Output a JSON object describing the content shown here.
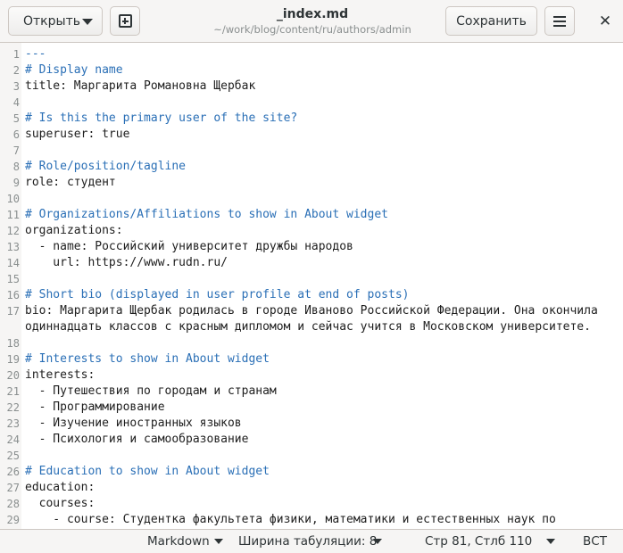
{
  "header": {
    "open_label": "Открыть",
    "save_label": "Сохранить",
    "title": "_index.md",
    "path": "~/work/blog/content/ru/authors/admin",
    "close_glyph": "✕"
  },
  "editor": {
    "lines": [
      {
        "n": "1",
        "text": "---",
        "kind": "comment"
      },
      {
        "n": "2",
        "text": "# Display name",
        "kind": "comment"
      },
      {
        "n": "3",
        "text": "title: Маргарита Романовна Щербак",
        "kind": "text"
      },
      {
        "n": "4",
        "text": "",
        "kind": "text"
      },
      {
        "n": "5",
        "text": "# Is this the primary user of the site?",
        "kind": "comment"
      },
      {
        "n": "6",
        "text": "superuser: true",
        "kind": "text"
      },
      {
        "n": "7",
        "text": "",
        "kind": "text"
      },
      {
        "n": "8",
        "text": "# Role/position/tagline",
        "kind": "comment"
      },
      {
        "n": "9",
        "text": "role: студент",
        "kind": "text"
      },
      {
        "n": "10",
        "text": "",
        "kind": "text"
      },
      {
        "n": "11",
        "text": "# Organizations/Affiliations to show in About widget",
        "kind": "comment"
      },
      {
        "n": "12",
        "text": "organizations:",
        "kind": "text"
      },
      {
        "n": "13",
        "text": "  - name: Российский университет дружбы народов",
        "kind": "text"
      },
      {
        "n": "14",
        "text": "    url: https://www.rudn.ru/",
        "kind": "text"
      },
      {
        "n": "15",
        "text": "",
        "kind": "text"
      },
      {
        "n": "16",
        "text": "# Short bio (displayed in user profile at end of posts)",
        "kind": "comment"
      },
      {
        "n": "17",
        "text": "bio: Маргарита Щербак родилась в городе Иваново Российской Федерации. Она окончила",
        "kind": "text"
      },
      {
        "n": "",
        "text": "одиннадцать классов с красным дипломом и сейчас учится в Московском университете.",
        "kind": "text"
      },
      {
        "n": "18",
        "text": "",
        "kind": "text"
      },
      {
        "n": "19",
        "text": "# Interests to show in About widget",
        "kind": "comment"
      },
      {
        "n": "20",
        "text": "interests:",
        "kind": "text"
      },
      {
        "n": "21",
        "text": "  - Путешествия по городам и странам",
        "kind": "text"
      },
      {
        "n": "22",
        "text": "  - Программирование",
        "kind": "text"
      },
      {
        "n": "23",
        "text": "  - Изучение иностранных языков",
        "kind": "text"
      },
      {
        "n": "24",
        "text": "  - Психология и самообразование",
        "kind": "text"
      },
      {
        "n": "25",
        "text": "",
        "kind": "text"
      },
      {
        "n": "26",
        "text": "# Education to show in About widget",
        "kind": "comment"
      },
      {
        "n": "27",
        "text": "education:",
        "kind": "text"
      },
      {
        "n": "28",
        "text": "  courses:",
        "kind": "text"
      },
      {
        "n": "29",
        "text": "    - course: Студентка факультета физики, математики и естественных наук по",
        "kind": "text"
      }
    ]
  },
  "status": {
    "language": "Markdown",
    "tab_width": "Ширина табуляции: 8",
    "position": "Стр 81, Стлб 110",
    "mode": "ВСТ"
  }
}
